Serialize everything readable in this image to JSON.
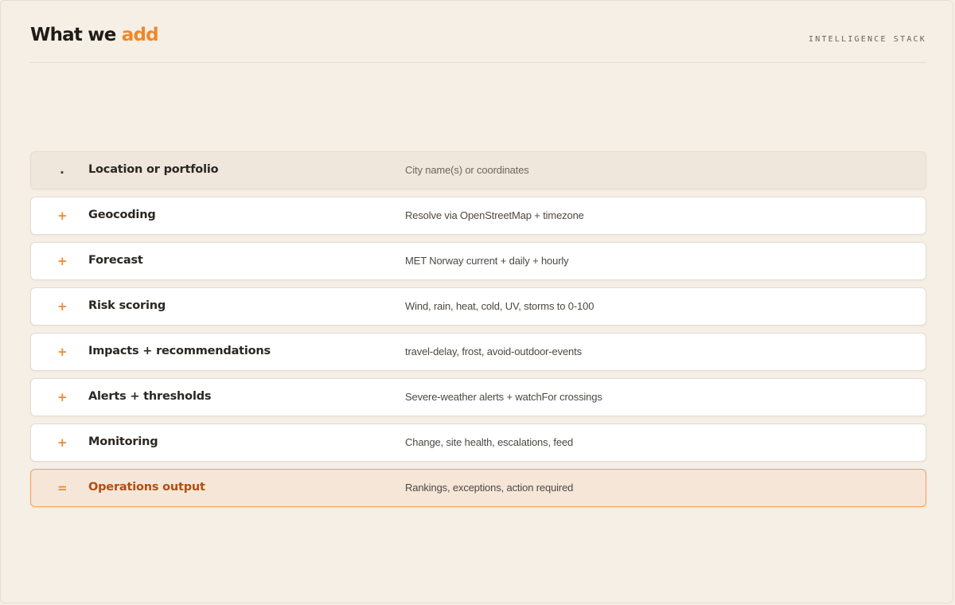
{
  "header": {
    "title_main": "What we ",
    "title_accent": "add",
    "kicker": "INTELLIGENCE STACK"
  },
  "colors": {
    "background": "#f5efe5",
    "accent": "#f0872a",
    "output_text": "#b04f12",
    "output_border": "#f0a158"
  },
  "stack": [
    {
      "marker": ".",
      "label": "Location or portfolio",
      "description": "City name(s) or coordinates",
      "kind": "input"
    },
    {
      "marker": "+",
      "label": "Geocoding",
      "description": "Resolve via OpenStreetMap + timezone",
      "kind": "step"
    },
    {
      "marker": "+",
      "label": "Forecast",
      "description": "MET Norway current + daily + hourly",
      "kind": "step"
    },
    {
      "marker": "+",
      "label": "Risk scoring",
      "description": "Wind, rain, heat, cold, UV, storms to 0-100",
      "kind": "step"
    },
    {
      "marker": "+",
      "label": "Impacts + recommendations",
      "description": "travel-delay, frost, avoid-outdoor-events",
      "kind": "step"
    },
    {
      "marker": "+",
      "label": "Alerts + thresholds",
      "description": "Severe-weather alerts + watchFor crossings",
      "kind": "step"
    },
    {
      "marker": "+",
      "label": "Monitoring",
      "description": "Change, site health, escalations, feed",
      "kind": "step"
    },
    {
      "marker": "=",
      "label": "Operations output",
      "description": "Rankings, exceptions, action required",
      "kind": "output"
    }
  ]
}
